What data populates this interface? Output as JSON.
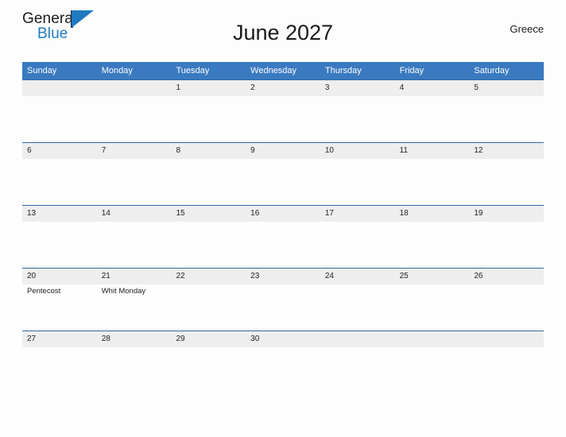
{
  "brand": {
    "name_part1": "General",
    "name_part2": "Blue",
    "accent_color": "#1f7ac0",
    "triangle_icon": "triangle-icon"
  },
  "header": {
    "title": "June 2027",
    "country": "Greece"
  },
  "calendar": {
    "month": "June",
    "year": "2027",
    "header_bg": "#3a7ac0",
    "date_strip_bg": "#eeeeee",
    "rule_color": "#2c6ba8",
    "weekdays": [
      "Sunday",
      "Monday",
      "Tuesday",
      "Wednesday",
      "Thursday",
      "Friday",
      "Saturday"
    ],
    "weeks": [
      [
        {
          "day": "",
          "events": []
        },
        {
          "day": "",
          "events": []
        },
        {
          "day": "1",
          "events": []
        },
        {
          "day": "2",
          "events": []
        },
        {
          "day": "3",
          "events": []
        },
        {
          "day": "4",
          "events": []
        },
        {
          "day": "5",
          "events": []
        }
      ],
      [
        {
          "day": "6",
          "events": []
        },
        {
          "day": "7",
          "events": []
        },
        {
          "day": "8",
          "events": []
        },
        {
          "day": "9",
          "events": []
        },
        {
          "day": "10",
          "events": []
        },
        {
          "day": "11",
          "events": []
        },
        {
          "day": "12",
          "events": []
        }
      ],
      [
        {
          "day": "13",
          "events": []
        },
        {
          "day": "14",
          "events": []
        },
        {
          "day": "15",
          "events": []
        },
        {
          "day": "16",
          "events": []
        },
        {
          "day": "17",
          "events": []
        },
        {
          "day": "18",
          "events": []
        },
        {
          "day": "19",
          "events": []
        }
      ],
      [
        {
          "day": "20",
          "events": [
            "Pentecost"
          ]
        },
        {
          "day": "21",
          "events": [
            "Whit Monday"
          ]
        },
        {
          "day": "22",
          "events": []
        },
        {
          "day": "23",
          "events": []
        },
        {
          "day": "24",
          "events": []
        },
        {
          "day": "25",
          "events": []
        },
        {
          "day": "26",
          "events": []
        }
      ],
      [
        {
          "day": "27",
          "events": []
        },
        {
          "day": "28",
          "events": []
        },
        {
          "day": "29",
          "events": []
        },
        {
          "day": "30",
          "events": []
        },
        {
          "day": "",
          "events": []
        },
        {
          "day": "",
          "events": []
        },
        {
          "day": "",
          "events": []
        }
      ]
    ]
  }
}
